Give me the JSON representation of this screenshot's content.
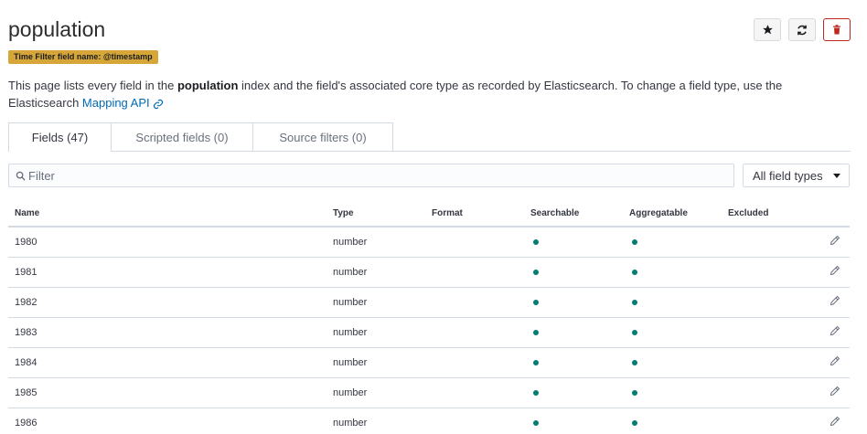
{
  "page": {
    "title": "population",
    "badge": "Time Filter field name: @timestamp",
    "desc_pre": "This page lists every field in the ",
    "desc_index": "population",
    "desc_post": " index and the field's associated core type as recorded by Elasticsearch. To change a field type, use the Elasticsearch ",
    "desc_link": "Mapping API"
  },
  "icons": {
    "favorite": "star-icon",
    "refresh": "refresh-icon",
    "delete": "trash-icon",
    "search": "search-icon",
    "link": "link-icon",
    "edit": "pencil-icon"
  },
  "colors": {
    "badge_bg": "#d6a738",
    "delete_accent": "#bd271e",
    "link": "#006bb4",
    "dot": "#017d73"
  },
  "tabs": [
    {
      "label": "Fields (47)"
    },
    {
      "label": "Scripted fields (0)"
    },
    {
      "label": "Source filters (0)"
    }
  ],
  "filter": {
    "placeholder": "Filter",
    "value": ""
  },
  "type_select": {
    "selected": "All field types"
  },
  "table": {
    "headers": [
      "Name",
      "Type",
      "Format",
      "Searchable",
      "Aggregatable",
      "Excluded"
    ],
    "rows": [
      {
        "name": "1980",
        "type": "number",
        "format": "",
        "searchable": true,
        "aggregatable": true,
        "excluded": false
      },
      {
        "name": "1981",
        "type": "number",
        "format": "",
        "searchable": true,
        "aggregatable": true,
        "excluded": false
      },
      {
        "name": "1982",
        "type": "number",
        "format": "",
        "searchable": true,
        "aggregatable": true,
        "excluded": false
      },
      {
        "name": "1983",
        "type": "number",
        "format": "",
        "searchable": true,
        "aggregatable": true,
        "excluded": false
      },
      {
        "name": "1984",
        "type": "number",
        "format": "",
        "searchable": true,
        "aggregatable": true,
        "excluded": false
      },
      {
        "name": "1985",
        "type": "number",
        "format": "",
        "searchable": true,
        "aggregatable": true,
        "excluded": false
      },
      {
        "name": "1986",
        "type": "number",
        "format": "",
        "searchable": true,
        "aggregatable": true,
        "excluded": false
      }
    ]
  }
}
